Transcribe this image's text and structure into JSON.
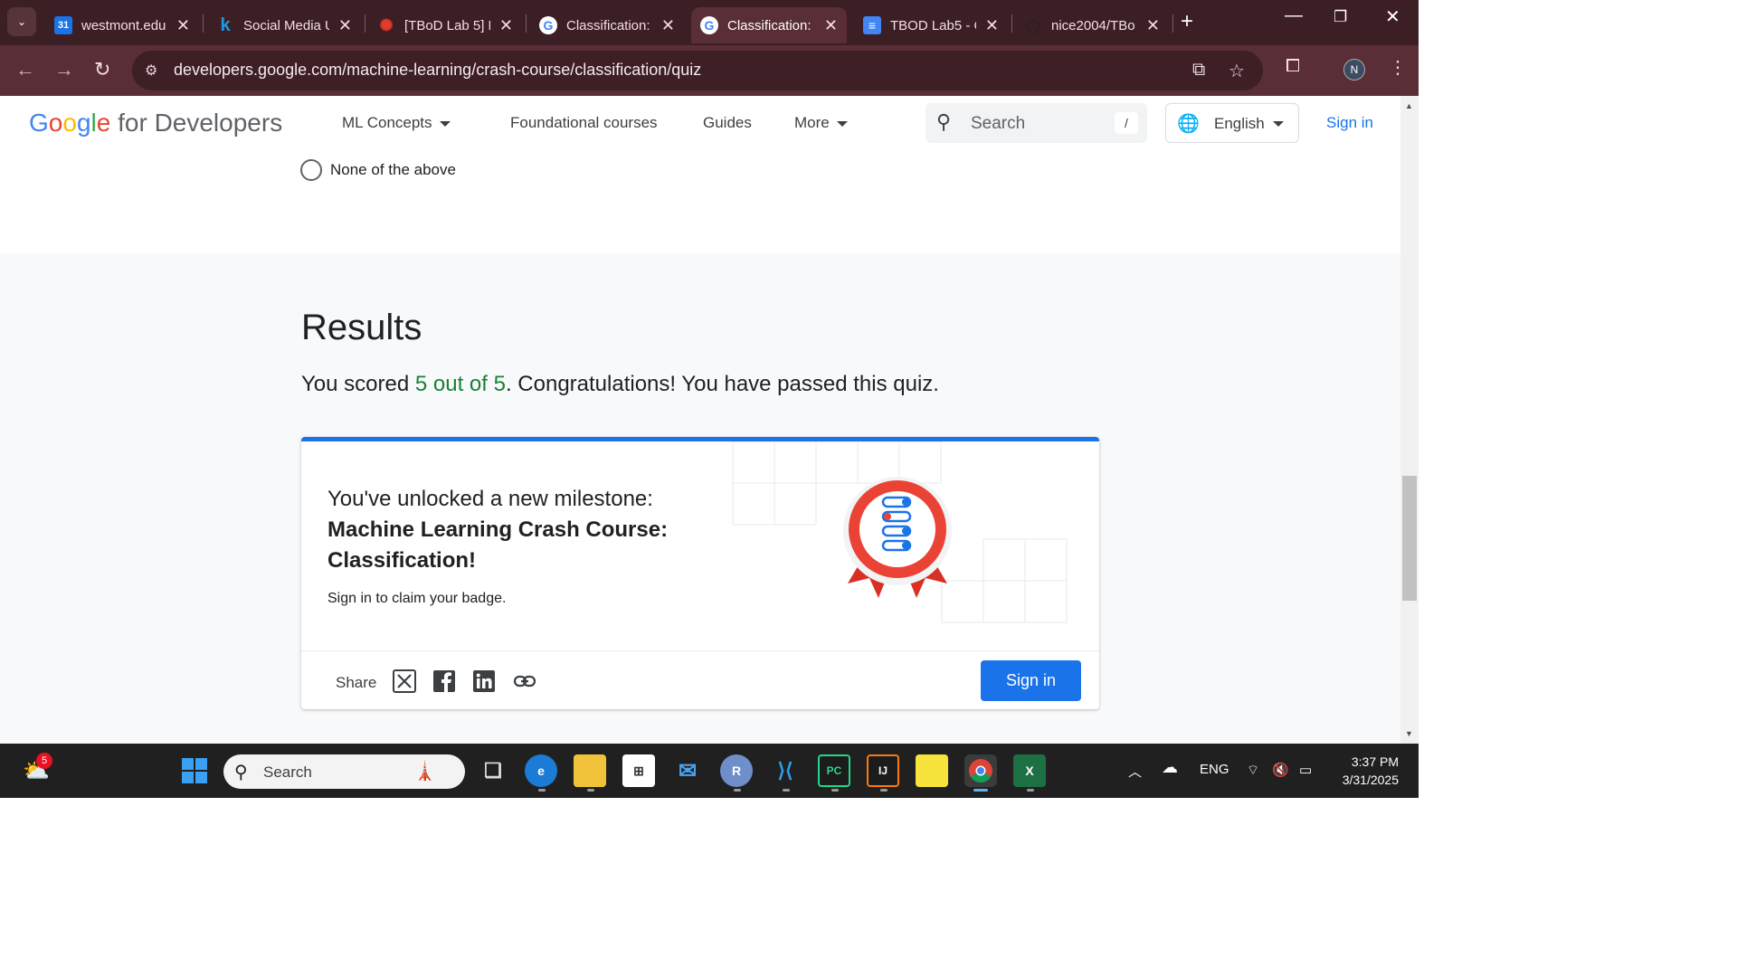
{
  "tabs": [
    {
      "title": "westmont.edu",
      "icon": "calendar-icon",
      "fav": "31"
    },
    {
      "title": "Social Media U",
      "icon": "k-icon",
      "fav": "k"
    },
    {
      "title": "[TBoD Lab 5] E",
      "icon": "canvas-icon",
      "fav": "✺"
    },
    {
      "title": "Classification:",
      "icon": "google-icon",
      "fav": "G"
    },
    {
      "title": "Classification:",
      "icon": "google-icon",
      "fav": "G"
    },
    {
      "title": "TBOD Lab5 - C",
      "icon": "docs-icon",
      "fav": "≡"
    },
    {
      "title": "nice2004/TBo",
      "icon": "github-icon",
      "fav": "◯"
    }
  ],
  "address": {
    "url": "developers.google.com/machine-learning/crash-course/classification/quiz"
  },
  "profile_initial": "N",
  "header": {
    "logo_google": "Google",
    "logo_rest": " for Developers",
    "nav": [
      "ML Concepts",
      "Foundational courses",
      "Guides",
      "More"
    ],
    "search_placeholder": "Search",
    "search_shortcut": "/",
    "language": "English",
    "signin": "Sign in"
  },
  "quiz": {
    "option_label": "None of the above"
  },
  "results": {
    "heading": "Results",
    "score_prefix": "You scored ",
    "score_value": "5 out of 5",
    "score_suffix": ". Congratulations! You have passed this quiz."
  },
  "milestone": {
    "line1": "You've unlocked a new milestone:",
    "line2": "Machine Learning Crash Course:",
    "line3": "Classification!",
    "claim": "Sign in to claim your badge.",
    "share_label": "Share",
    "signin_button": "Sign in"
  },
  "taskbar": {
    "search_placeholder": "Search",
    "weather_badge": "5",
    "tray_lang": "ENG",
    "time": "3:37 PM",
    "date": "3/31/2025"
  },
  "colors": {
    "accent": "#1a73e8",
    "score_green": "#188038",
    "tabstrip": "#3c1f25",
    "toolbar": "#5a2e36"
  }
}
